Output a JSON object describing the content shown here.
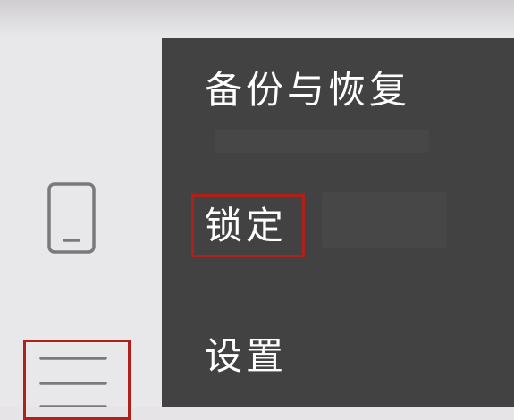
{
  "drawer": {
    "items": [
      {
        "label": "备份与恢复"
      },
      {
        "label": "锁定"
      },
      {
        "label": "设置"
      }
    ]
  },
  "rail": {
    "icons": [
      "phone-icon",
      "hamburger-menu-icon"
    ]
  },
  "colors": {
    "drawer_bg": "#434242",
    "rail_bg": "#e8e7e9",
    "highlight": "#b0201a",
    "text": "#ffffff"
  }
}
